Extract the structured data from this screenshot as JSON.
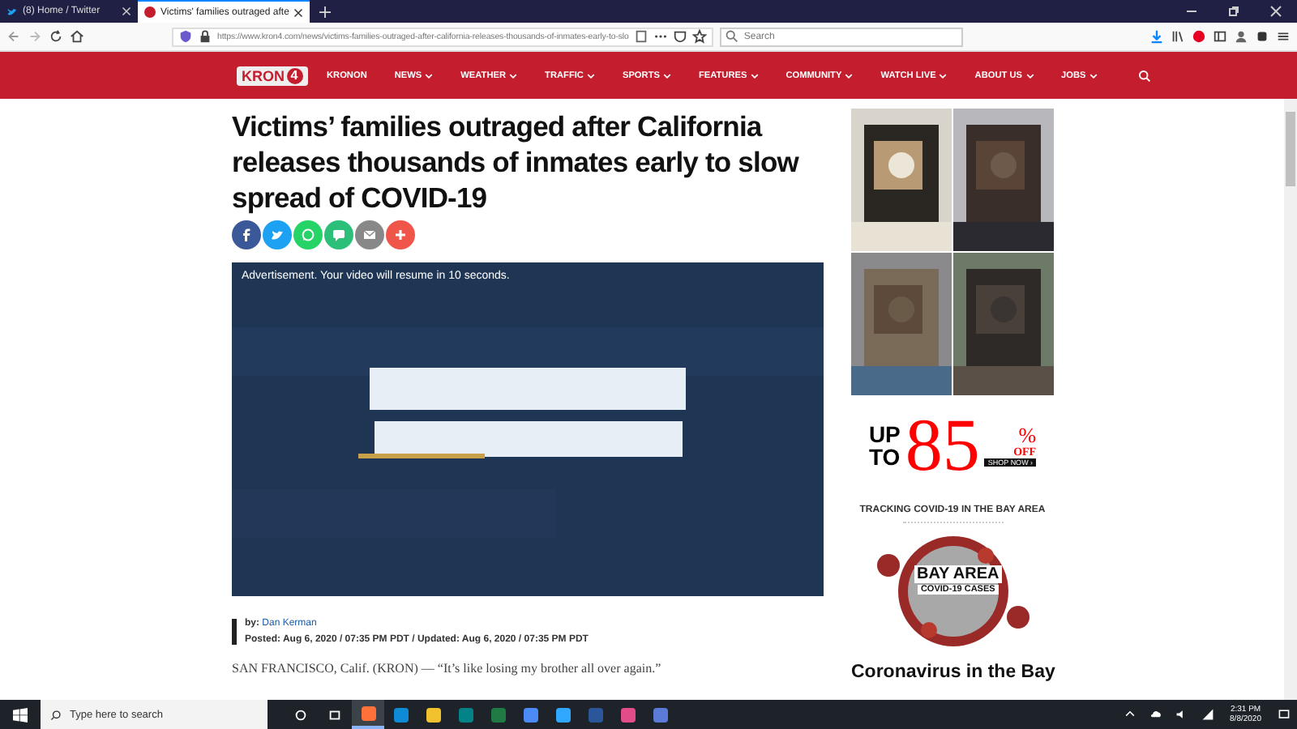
{
  "browser": {
    "tabs": [
      {
        "title": "(8) Home / Twitter",
        "selected": false
      },
      {
        "title": "Victims' families outraged afte",
        "selected": true
      }
    ],
    "url": "https://www.kron4.com/news/victims-families-outraged-after-california-releases-thousands-of-inmates-early-to-slo",
    "search": {
      "placeholder": "Search"
    }
  },
  "site": {
    "logo": "KRON",
    "logo_badge": "4",
    "nav": [
      {
        "label": "KRONON",
        "dropdown": false
      },
      {
        "label": "NEWS",
        "dropdown": true
      },
      {
        "label": "WEATHER",
        "dropdown": true
      },
      {
        "label": "TRAFFIC",
        "dropdown": true
      },
      {
        "label": "SPORTS",
        "dropdown": true
      },
      {
        "label": "FEATURES",
        "dropdown": true
      },
      {
        "label": "COMMUNITY",
        "dropdown": true
      },
      {
        "label": "WATCH LIVE",
        "dropdown": true
      },
      {
        "label": "ABOUT US",
        "dropdown": true
      },
      {
        "label": "JOBS",
        "dropdown": true
      }
    ]
  },
  "article": {
    "headline": "Victims’ families outraged after California releases thousands of inmates early to slow spread of COVID-19",
    "share": [
      {
        "kind": "facebook",
        "color": "#3b5998"
      },
      {
        "kind": "twitter",
        "color": "#1da1f2"
      },
      {
        "kind": "whatsapp",
        "color": "#25d366"
      },
      {
        "kind": "sms",
        "color": "#2bbf7a"
      },
      {
        "kind": "email",
        "color": "#888888"
      },
      {
        "kind": "more",
        "color": "#f0554a"
      }
    ],
    "video": {
      "notice": "Advertisement. Your video will resume in 10 seconds."
    },
    "byline_prefix": "by:",
    "author": "Dan Kerman",
    "posted": "Posted: Aug 6, 2020 / 07:35 PM PDT / Updated: Aug 6, 2020 / 07:35 PM PDT",
    "paragraph": "SAN FRANCISCO, Calif. (KRON) — “It’s like losing my brother all over again.”"
  },
  "sidebar": {
    "promo": {
      "up": "UP",
      "to": "TO",
      "amount": "85",
      "percent": "%",
      "off": "OFF",
      "cta": "SHOP NOW ›"
    },
    "tracking_title": "TRACKING COVID-19 IN THE BAY AREA",
    "covid_image": {
      "label": "BAY AREA",
      "sublabel": "COVID-19 CASES"
    },
    "story_headline": "Coronavirus in the Bay"
  },
  "taskbar": {
    "search_placeholder": "Type here to search",
    "apps": [
      {
        "color": "#ff7139",
        "selected": true
      },
      {
        "color": "#0f8bd6",
        "selected": false
      },
      {
        "color": "#f2c12e",
        "selected": false
      },
      {
        "color": "#038387",
        "selected": false
      },
      {
        "color": "#1f7a44",
        "selected": false
      },
      {
        "color": "#4c8bf5",
        "selected": false
      },
      {
        "color": "#31a8ff",
        "selected": false
      },
      {
        "color": "#2b579a",
        "selected": false
      },
      {
        "color": "#e24c89",
        "selected": false
      },
      {
        "color": "#5a7bd8",
        "selected": false
      }
    ],
    "time": "2:31 PM",
    "date": "8/8/2020"
  }
}
